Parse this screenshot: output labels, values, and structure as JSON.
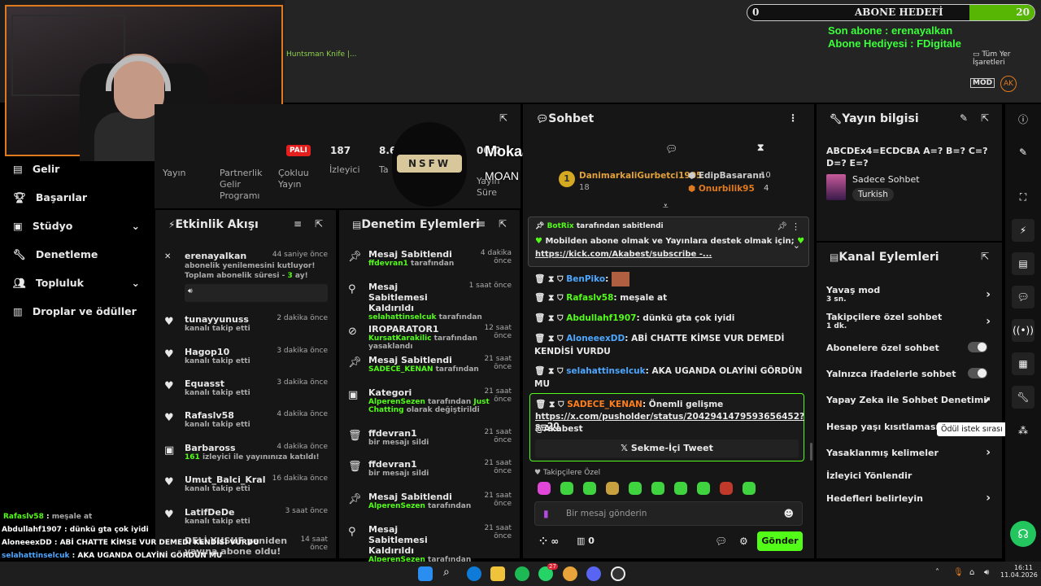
{
  "topbar": {
    "bookmark_left": "Huntsman Knife |...",
    "bookmark_right": "Tüm Yer İşaretleri",
    "goal_title": "ABONE HEDEFİ",
    "goal_min": "0",
    "goal_max": "20",
    "last_sub": "Son abone : erenayalkan",
    "gift_sub": "Abone Hediyesi : FDigitale"
  },
  "sidebar": {
    "items": [
      {
        "label": "Gelir"
      },
      {
        "label": "Başarılar"
      },
      {
        "label": "Stüdyo"
      },
      {
        "label": "Denetleme"
      },
      {
        "label": "Topluluk"
      },
      {
        "label": "Droplar ve ödüller"
      }
    ]
  },
  "stats": {
    "label1": "Yayın",
    "label2": "Partnerlik Gelir Programı",
    "badge": "PALI",
    "label3": "Çokluu Yayın",
    "viewers": "187",
    "viewers_label": "İzleyici",
    "value2": "8.6",
    "value2_label": "Ta",
    "value3": "00:0",
    "value3_label": "Yayın Süre"
  },
  "alert": {
    "logo": "NSFW",
    "title": "Mokaa played a Sound!",
    "sub": "MOAN Blerp"
  },
  "events": {
    "title": "Etkinlik Akışı",
    "items": [
      {
        "name": "erenayalkan",
        "time": "44 saniye önce",
        "line1": "abonelik yenilemesini kutluyor! Toplam abonelik süresi -",
        "months": "3",
        "line2": "ay!"
      },
      {
        "name": "tunayyunuss",
        "time": "2 dakika önce",
        "sub": "kanalı takip etti"
      },
      {
        "name": "Hagop10",
        "time": "3 dakika önce",
        "sub": "kanalı takip etti"
      },
      {
        "name": "Equasst",
        "time": "3 dakika önce",
        "sub": "kanalı takip etti"
      },
      {
        "name": "Rafaslv58",
        "time": "4 dakika önce",
        "sub": "kanalı takip etti"
      },
      {
        "name": "Barbaross",
        "time": "4 dakika önce",
        "sub_num": "161",
        "sub": "izleyici ile yayınınıza katıldı!"
      },
      {
        "name": "Umut_Balci_Kral",
        "time": "16 dakika önce",
        "sub": "kanalı takip etti"
      },
      {
        "name": "LatifDeDe",
        "time": "3 saat önce",
        "sub": "kanalı takip etti"
      },
      {
        "name": "DELİ YUSUF yeniden yayına abone oldu!",
        "time": "14 saat önce"
      }
    ]
  },
  "mod": {
    "title": "Denetim Eylemleri",
    "items": [
      {
        "title": "Mesaj Sabitlendi",
        "user": "ffdevran1",
        "rest": "tarafından",
        "time": "4 dakika önce"
      },
      {
        "title": "Mesaj Sabitlemesi Kaldırıldı",
        "user": "selahattinselcuk",
        "rest": "tarafından",
        "time": "1 saat önce"
      },
      {
        "title": "IROPARATOR1",
        "user": "KursatKarakilic",
        "rest": "tarafından yasaklandı",
        "time": "12 saat önce"
      },
      {
        "title": "Mesaj Sabitlendi",
        "user": "SADECE_KENAN",
        "rest": "tarafından",
        "time": "21 saat önce"
      },
      {
        "title": "Kategori",
        "user": "AlperenSezen",
        "rest": "tarafından",
        "extra": "Just Chatting",
        "rest2": "olarak değiştirildi",
        "time": "21 saat önce"
      },
      {
        "title": "ffdevran1",
        "rest": "bir mesajı sildi",
        "time": "21 saat önce"
      },
      {
        "title": "ffdevran1",
        "rest": "bir mesajı sildi",
        "time": "21 saat önce"
      },
      {
        "title": "Mesaj Sabitlendi",
        "user": "AlperenSezen",
        "rest": "tarafından",
        "time": "21 saat önce"
      },
      {
        "title": "Mesaj Sabitlemesi Kaldırıldı",
        "user": "AlperenSezen",
        "rest": "tarafından",
        "time": "21 saat önce"
      }
    ]
  },
  "chat": {
    "title": "Sohbet",
    "top1_name": "DanimarkaliGurbetci1905",
    "top1_count": "18",
    "top2_name": "EdipBasarann",
    "top2_count": "10",
    "top3_name": "Onurbilik95",
    "top3_count": "4",
    "pinned_by": "BotRix",
    "pinned_rest": "tarafından sabitlendi",
    "pinned_text": "Mobilden abone olmak ve Yayınlara destek olmak için;",
    "pinned_link": "https://kick.com/Akabest/subscribe -...",
    "messages": [
      {
        "user": "BenPiko",
        "text": ""
      },
      {
        "user": "Rafaslv58",
        "text": "meşale at"
      },
      {
        "user": "Abdullahf1907",
        "text": "dünkü gta çok iyidi"
      },
      {
        "user": "AloneeexDD",
        "text": "ABİ CHATTE KİMSE VUR DEMEDİ KENDİSİ VURDU"
      },
      {
        "user": "selahattinselcuk",
        "text": "AKA UGANDA OLAYİNİ GÖRDÜN MU"
      },
      {
        "user": "SADECE_KENAN",
        "text": "Önemli gelişme",
        "link": "https://x.com/pusholder/status/2042941479593656452?s=20",
        "mention": "@Akabest"
      }
    ],
    "tweet_button": "Sekme-İçi Tweet",
    "followers_only": "Takipçilere Özel",
    "input_placeholder": "Bir mesaj gönderin",
    "points": "0",
    "send": "Gönder"
  },
  "info": {
    "title": "Yayın bilgisi",
    "stream_title": "ABCDEx4=ECDCBA A=? B=? C=? D=? E=?",
    "category": "Sadece Sohbet",
    "language": "Turkish"
  },
  "actions": {
    "title": "Kanal Eylemleri",
    "items": [
      {
        "label": "Yavaş mod",
        "sub": "3 sn."
      },
      {
        "label": "Takipçilere özel sohbet",
        "sub": "1 dk."
      },
      {
        "label": "Abonelere özel sohbet"
      },
      {
        "label": "Yalnızca ifadelerle sohbet"
      },
      {
        "label": "Yapay Zeka ile Sohbet Denetimi"
      },
      {
        "label": "Hesap yaşı kısıtlaması"
      },
      {
        "label": "Yasaklanmış kelimeler"
      },
      {
        "label": "İzleyici Yönlendir"
      },
      {
        "label": "Hedefleri belirleyin"
      }
    ],
    "tooltip": "Ödül istek sırası"
  },
  "overlay_chat": [
    {
      "user": "Rafaslv58",
      "text": "meşale at"
    },
    {
      "user": "Abdullahf1907",
      "text": "dünkü gta çok iyidi"
    },
    {
      "user": "AloneeexDD",
      "text": "ABİ CHATTE KİMSE VUR DEMEDİ KENDİSİ VURDU"
    },
    {
      "user": "selahattinselcuk",
      "text": "AKA UGANDA OLAYİNİ GÖRDÜN MU"
    },
    {
      "user": "SADECE_KENAN",
      "text": "Önemli gelişme"
    },
    {
      "user": "",
      "text": "https://x.com/pusholder/status/2042941479593656452?s=20 @Akabest"
    }
  ],
  "taskbar": {
    "time": "16:11",
    "date": "11.04.2026",
    "badge1": "27"
  }
}
